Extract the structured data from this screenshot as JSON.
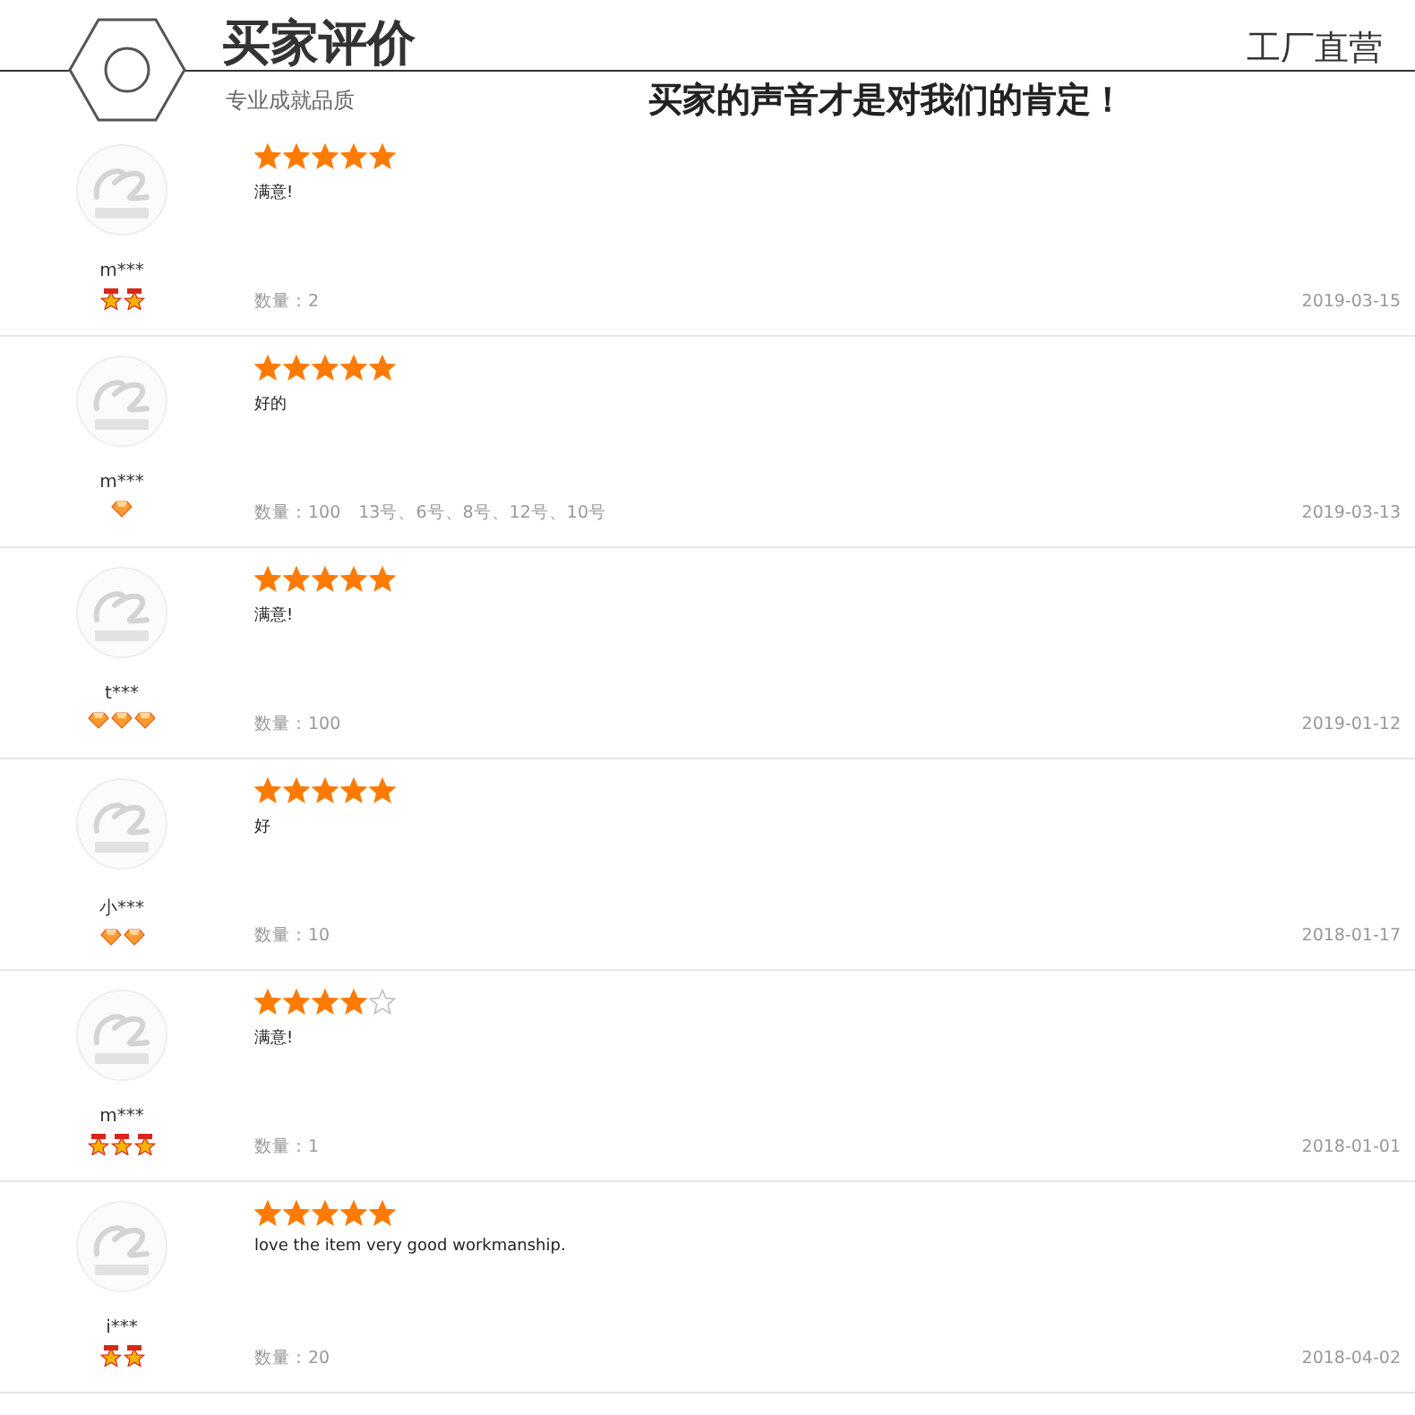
{
  "header": {
    "title": "买家评价",
    "subtitle": "专业成就品质",
    "tagline": "工厂直营",
    "slogan": "买家的声音才是对我们的肯定！"
  },
  "reviews": [
    {
      "user": "m***",
      "badges": [
        {
          "kind": "medal"
        },
        {
          "kind": "medal"
        }
      ],
      "stars": 5,
      "comment": "满意!",
      "quantity": "数量：2",
      "date": "2019-03-15"
    },
    {
      "user": "m***",
      "badges": [
        {
          "kind": "diamond"
        }
      ],
      "stars": 5,
      "comment": "好的",
      "quantity": "数量：100　13号、6号、8号、12号、10号",
      "date": "2019-03-13"
    },
    {
      "user": "t***",
      "badges": [
        {
          "kind": "diamond"
        },
        {
          "kind": "diamond"
        },
        {
          "kind": "diamond"
        }
      ],
      "stars": 5,
      "comment": "满意!",
      "quantity": "数量：100",
      "date": "2019-01-12"
    },
    {
      "user": "小***",
      "badges": [
        {
          "kind": "diamond"
        },
        {
          "kind": "diamond"
        }
      ],
      "stars": 5,
      "comment": "好",
      "quantity": "数量：10",
      "date": "2018-01-17"
    },
    {
      "user": "m***",
      "badges": [
        {
          "kind": "medal"
        },
        {
          "kind": "medal"
        },
        {
          "kind": "medal"
        }
      ],
      "stars": 4,
      "comment": "满意!",
      "quantity": "数量：1",
      "date": "2018-01-01"
    },
    {
      "user": "i***",
      "badges": [
        {
          "kind": "medal"
        },
        {
          "kind": "medal"
        }
      ],
      "stars": 5,
      "comment": "love the item very good workmanship.",
      "quantity": "数量：20",
      "date": "2018-04-02"
    }
  ]
}
